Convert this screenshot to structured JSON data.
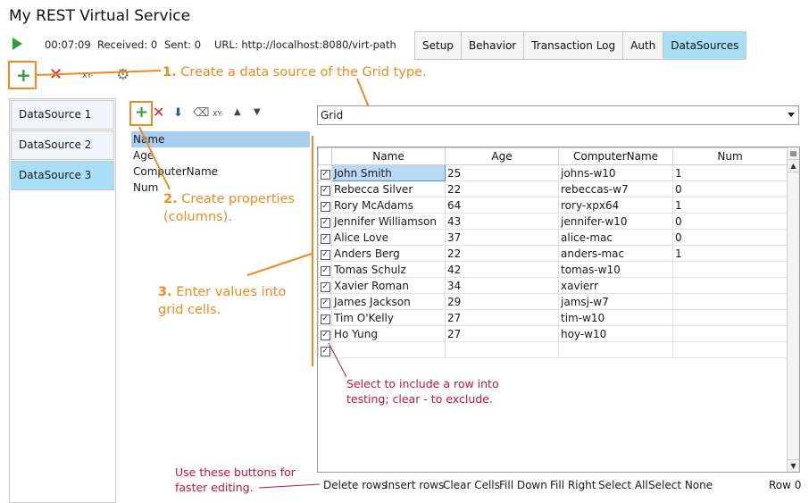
{
  "window": {
    "title": "My REST Virtual Service"
  },
  "status": {
    "elapsed": "00:07:09",
    "received": "Received: 0",
    "sent": "Sent: 0",
    "url": "URL: http://localhost:8080/virt-path"
  },
  "tabs": [
    {
      "label": "Setup",
      "active": false
    },
    {
      "label": "Behavior",
      "active": false
    },
    {
      "label": "Transaction Log",
      "active": false
    },
    {
      "label": "Auth",
      "active": false
    },
    {
      "label": "DataSources",
      "active": true
    }
  ],
  "toolbar": {
    "xy_label": "XY-"
  },
  "datasources": [
    "DataSource 1",
    "DataSource 2",
    "DataSource 3"
  ],
  "properties": {
    "toolbar_xy_label": "XY-",
    "items": [
      "Name",
      "Age",
      "ComputerName",
      "Num"
    ]
  },
  "source_type": {
    "selected": "Grid"
  },
  "grid": {
    "columns": [
      "Name",
      "Age",
      "ComputerName",
      "Num"
    ],
    "rows": [
      {
        "checked": true,
        "name": "John Smith",
        "age": "25",
        "computer": "johns-w10",
        "num": "1"
      },
      {
        "checked": true,
        "name": "Rebecca Silver",
        "age": "22",
        "computer": "rebeccas-w7",
        "num": "0"
      },
      {
        "checked": true,
        "name": "Rory McAdams",
        "age": "64",
        "computer": "rory-xpx64",
        "num": "1"
      },
      {
        "checked": true,
        "name": "Jennifer Williamson",
        "age": "43",
        "computer": "jennifer-w10",
        "num": "0"
      },
      {
        "checked": true,
        "name": "Alice Love",
        "age": "37",
        "computer": "alice-mac",
        "num": "0"
      },
      {
        "checked": true,
        "name": "Anders Berg",
        "age": "22",
        "computer": "anders-mac",
        "num": "1"
      },
      {
        "checked": true,
        "name": "Tomas Schulz",
        "age": "42",
        "computer": "tomas-w10",
        "num": ""
      },
      {
        "checked": true,
        "name": "Xavier Roman",
        "age": "34",
        "computer": "xavierr",
        "num": ""
      },
      {
        "checked": true,
        "name": "James Jackson",
        "age": "29",
        "computer": "jamsj-w7",
        "num": ""
      },
      {
        "checked": true,
        "name": "Tim O'Kelly",
        "age": "27",
        "computer": "tim-w10",
        "num": ""
      },
      {
        "checked": true,
        "name": "Ho Yung",
        "age": "27",
        "computer": "hoy-w10",
        "num": ""
      },
      {
        "checked": true,
        "name": "",
        "age": "",
        "computer": "",
        "num": ""
      }
    ]
  },
  "bottom_actions": [
    "Delete rows",
    "Insert rows",
    "Clear Cells",
    "Fill Down",
    "Fill Right",
    "Select All",
    "Select None"
  ],
  "row_indicator": "Row 0",
  "annotations": {
    "step1_num": "1.",
    "step1_text": "Create a data source of the Grid type.",
    "step2_num": "2.",
    "step2_text_a": "Create properties",
    "step2_text_b": "(columns).",
    "step3_num": "3.",
    "step3_text_a": "Enter values into",
    "step3_text_b": "grid cells.",
    "select_note_a": "Select to include a row into",
    "select_note_b": "testing; clear - to exclude.",
    "buttons_note_a": "Use these buttons for",
    "buttons_note_b": "faster editing."
  },
  "colors": {
    "accent": "#f08a1c",
    "tab_active": "#a9dff5",
    "note_red": "#c0143c",
    "add_green": "#2ea043",
    "delete_red": "#e02020"
  }
}
